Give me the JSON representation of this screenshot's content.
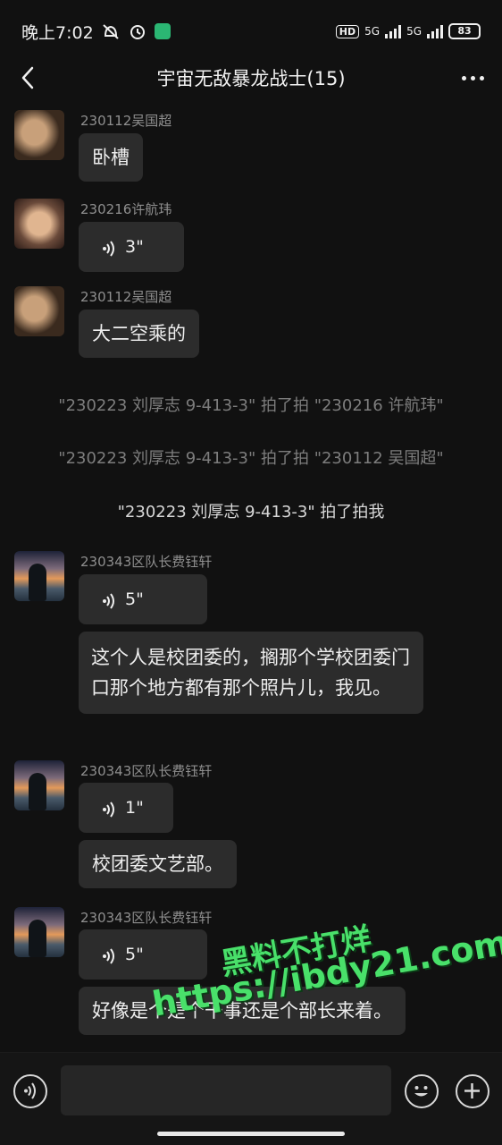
{
  "status_bar": {
    "time": "晚上7:02",
    "hd": "HD",
    "net1": "5G",
    "net2": "5G",
    "battery": "83"
  },
  "header": {
    "title": "宇宙无敌暴龙战士(15)"
  },
  "messages": [
    {
      "sender": "230112吴国超",
      "type": "text",
      "content": "卧槽"
    },
    {
      "sender": "230216许航玮",
      "type": "voice",
      "content": "3\""
    },
    {
      "sender": "230112吴国超",
      "type": "text",
      "content": "大二空乘的"
    },
    {
      "sender": "230343区队长费钰轩",
      "type": "voice",
      "content": "5\""
    },
    {
      "type": "text",
      "content": "这个人是校团委的，搁那个学校团委门口那个地方都有那个照片儿，我见。"
    },
    {
      "sender": "230343区队长费钰轩",
      "type": "voice",
      "content": "1\""
    },
    {
      "type": "text",
      "content": "校团委文艺部。"
    },
    {
      "sender": "230343区队长费钰轩",
      "type": "voice",
      "content": "5\""
    },
    {
      "type": "text",
      "content": "好像是个是个干事还是个部长来着。"
    }
  ],
  "system_notes": [
    "\"230223 刘厚志 9-413-3\" 拍了拍 \"230216 许航玮\"",
    "\"230223 刘厚志 9-413-3\" 拍了拍 \"230112 吴国超\"",
    "\"230223 刘厚志 9-413-3\" 拍了拍我"
  ],
  "watermark": {
    "line1": "黑料不打烊",
    "line2": "https://ibdy21.com"
  },
  "colors": {
    "background": "#111111",
    "bubble": "#2c2c2c",
    "watermark": "#49e06a"
  },
  "icons": [
    "back-arrow-icon",
    "more-dots-icon",
    "voice-wave-icon",
    "emoji-icon",
    "plus-icon",
    "mute-icon",
    "alarm-icon"
  ]
}
